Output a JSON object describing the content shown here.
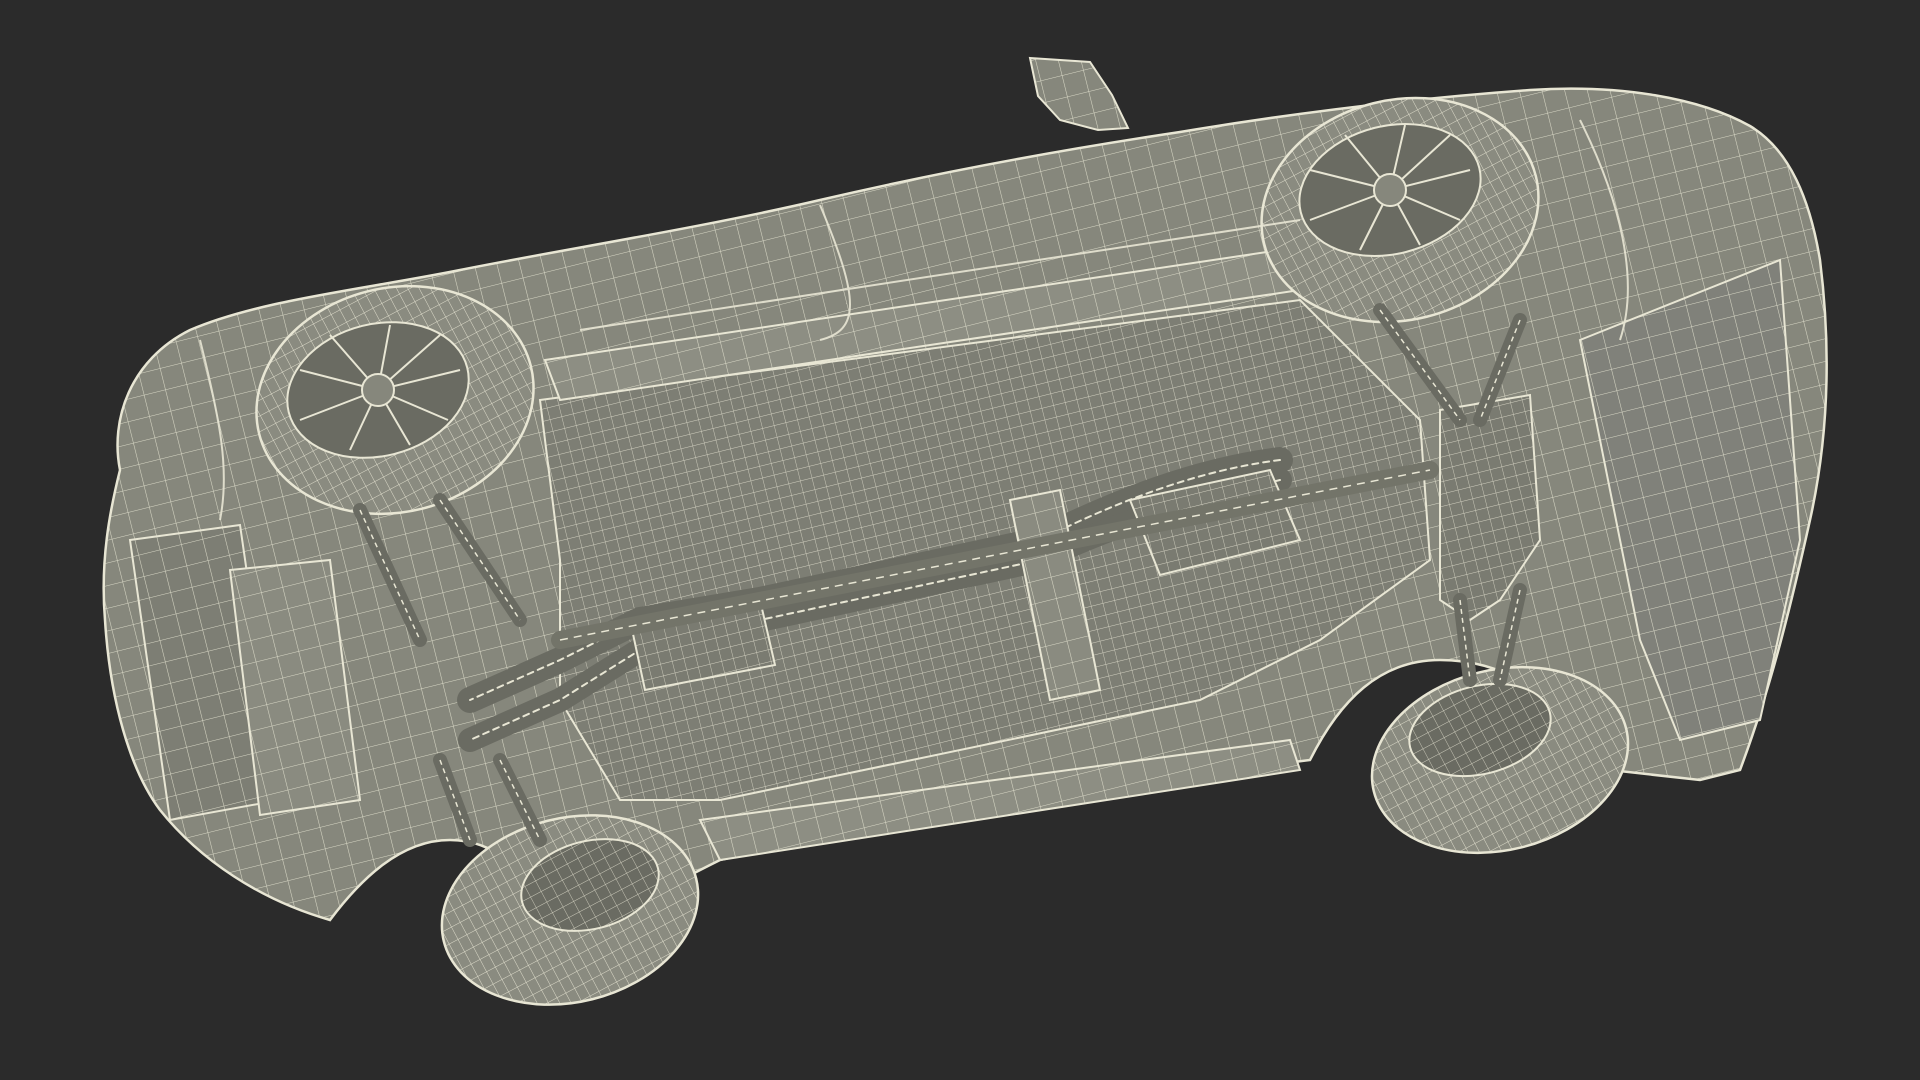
{
  "scene": {
    "subject": "wireframe-car-underside",
    "colors": {
      "background": "#2b2b2b",
      "body_fill": "#86877c",
      "body_shade": "#6f7066",
      "wire": "#e8e6d4",
      "tire_fill": "#8a8b80",
      "rim_fill": "#6a6b62",
      "shadow": "#55564f"
    }
  }
}
